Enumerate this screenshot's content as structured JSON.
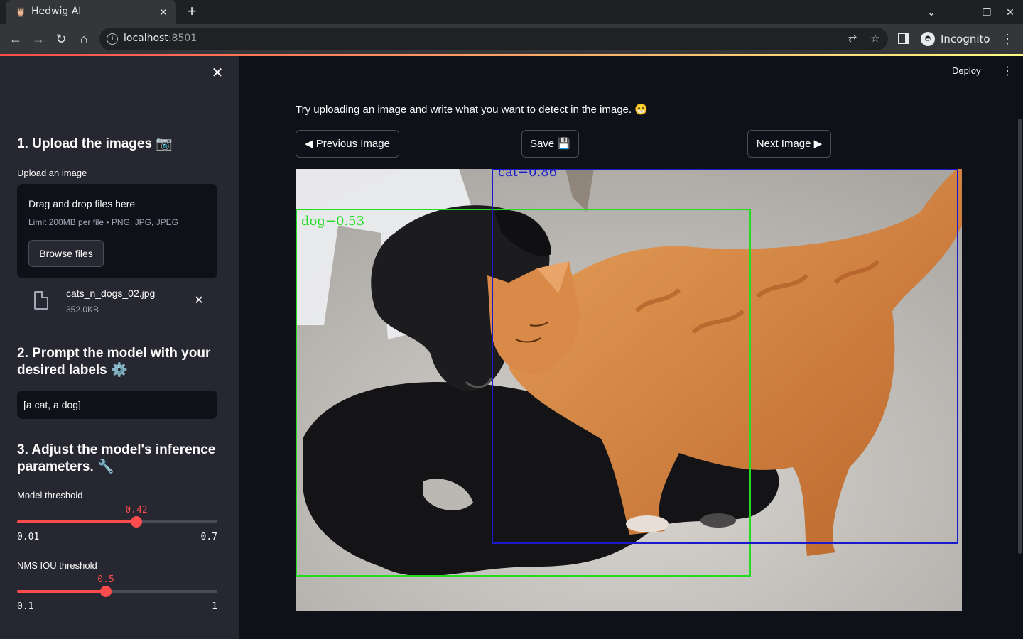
{
  "browser": {
    "tab_title": "Hedwig AI",
    "url_host": "localhost",
    "url_port": ":8501",
    "profile_label": "Incognito"
  },
  "sidebar": {
    "section1_title": "1. Upload the images 📷",
    "upload_label": "Upload an image",
    "dropzone_title": "Drag and drop files here",
    "dropzone_limit": "Limit 200MB per file • PNG, JPG, JPEG",
    "browse_button": "Browse files",
    "file_name": "cats_n_dogs_02.jpg",
    "file_size": "352.0KB",
    "section2_title": "2. Prompt the model with your desired labels ⚙️",
    "prompt_value": "[a cat, a dog]",
    "section3_title": "3. Adjust the model's inference parameters. 🔧",
    "model_threshold": {
      "label": "Model threshold",
      "value_text": "0.42",
      "value": 0.42,
      "min_text": "0.01",
      "max_text": "0.7",
      "min": 0.01,
      "max": 0.7
    },
    "nms_threshold": {
      "label": "NMS IOU threshold",
      "value_text": "0.5",
      "value": 0.5,
      "min_text": "0.1",
      "max_text": "1",
      "min": 0.1,
      "max": 1
    }
  },
  "main": {
    "deploy_label": "Deploy",
    "intro_text": "Try uploading an image and write what you want to detect in the image. 😁",
    "prev_button": "◀ Previous Image",
    "save_button": "Save 💾",
    "next_button": "Next Image ▶",
    "detections": [
      {
        "label": "dog−0.53",
        "color": "#22dd22"
      },
      {
        "label": "cat−0.86",
        "color": "#1a1acc"
      }
    ]
  },
  "colors": {
    "accent": "#ff4b4b",
    "sidebar_bg": "#262730",
    "main_bg": "#0e1117"
  }
}
